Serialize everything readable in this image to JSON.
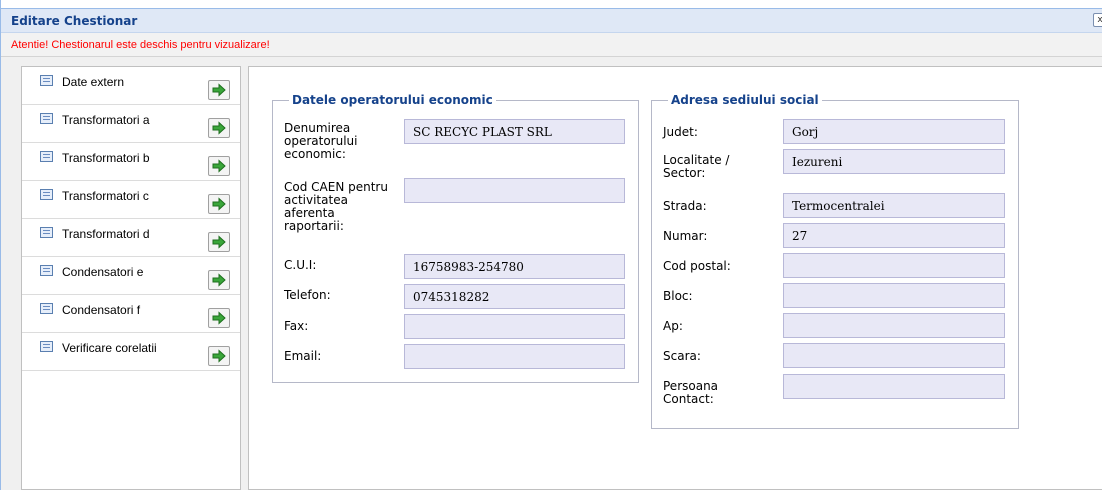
{
  "window": {
    "title": "Editare Chestionar",
    "close_symbol": "x",
    "warning": "Atentie! Chestionarul este deschis pentru vizualizare!"
  },
  "sidebar": {
    "items": [
      {
        "label": "Date extern",
        "icon": "document-icon",
        "action_icon": "green-arrow-right-icon"
      },
      {
        "label": "Transformatori a",
        "icon": "document-icon",
        "action_icon": "green-arrow-right-icon"
      },
      {
        "label": "Transformatori b",
        "icon": "document-icon",
        "action_icon": "green-arrow-right-icon"
      },
      {
        "label": "Transformatori c",
        "icon": "document-icon",
        "action_icon": "green-arrow-right-icon"
      },
      {
        "label": "Transformatori d",
        "icon": "document-icon",
        "action_icon": "green-arrow-right-icon"
      },
      {
        "label": "Condensatori e",
        "icon": "document-icon",
        "action_icon": "green-arrow-right-icon"
      },
      {
        "label": "Condensatori f",
        "icon": "document-icon",
        "action_icon": "green-arrow-right-icon"
      },
      {
        "label": "Verificare corelatii",
        "icon": "document-icon",
        "action_icon": "green-arrow-right-icon"
      }
    ]
  },
  "operator": {
    "legend": "Datele operatorului economic",
    "fields": [
      {
        "label": "Denumirea operatorului economic:",
        "value": "SC RECYC PLAST SRL"
      },
      {
        "label": "Cod CAEN pentru activitatea aferenta raportarii:",
        "value": ""
      },
      {
        "label": "C.U.I:",
        "value": "16758983-254780"
      },
      {
        "label": "Telefon:",
        "value": "0745318282"
      },
      {
        "label": "Fax:",
        "value": ""
      },
      {
        "label": "Email:",
        "value": ""
      }
    ]
  },
  "address": {
    "legend": "Adresa sediului social",
    "fields": [
      {
        "label": "Judet:",
        "value": "Gorj"
      },
      {
        "label": "Localitate / Sector:",
        "value": "Iezureni"
      },
      {
        "label": "Strada:",
        "value": "Termocentralei"
      },
      {
        "label": "Numar:",
        "value": "27"
      },
      {
        "label": "Cod postal:",
        "value": ""
      },
      {
        "label": "Bloc:",
        "value": ""
      },
      {
        "label": "Ap:",
        "value": ""
      },
      {
        "label": "Scara:",
        "value": ""
      },
      {
        "label": "Persoana Contact:",
        "value": ""
      }
    ]
  },
  "colors": {
    "title_text": "#15428b",
    "warning_text": "#ff0000",
    "input_bg": "#e8e8f6",
    "arrow_green": "#3aa63a"
  }
}
